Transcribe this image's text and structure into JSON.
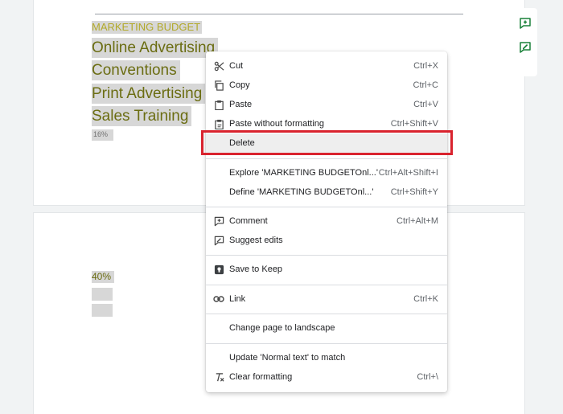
{
  "document": {
    "heading": "MARKETING BUDGET",
    "items": [
      "Online Advertising",
      "Conventions",
      "Print Advertising",
      "Sales Training"
    ],
    "small_value": "16%",
    "page2_value": "40%"
  },
  "context_menu": {
    "cut": {
      "label": "Cut",
      "shortcut": "Ctrl+X",
      "icon": "scissors-icon"
    },
    "copy": {
      "label": "Copy",
      "shortcut": "Ctrl+C",
      "icon": "copy-icon"
    },
    "paste": {
      "label": "Paste",
      "shortcut": "Ctrl+V",
      "icon": "clipboard-icon"
    },
    "paste_plain": {
      "label": "Paste without formatting",
      "shortcut": "Ctrl+Shift+V",
      "icon": "clipboard-text-icon"
    },
    "delete": {
      "label": "Delete"
    },
    "explore": {
      "label": "Explore 'MARKETING BUDGETOnl...'",
      "shortcut": "Ctrl+Alt+Shift+I"
    },
    "define": {
      "label": "Define 'MARKETING BUDGETOnl...'",
      "shortcut": "Ctrl+Shift+Y"
    },
    "comment": {
      "label": "Comment",
      "shortcut": "Ctrl+Alt+M",
      "icon": "add-comment-icon"
    },
    "suggest": {
      "label": "Suggest edits",
      "icon": "suggest-edit-icon"
    },
    "keep": {
      "label": "Save to Keep",
      "icon": "keep-icon"
    },
    "link": {
      "label": "Link",
      "shortcut": "Ctrl+K",
      "icon": "link-icon"
    },
    "landscape": {
      "label": "Change page to landscape"
    },
    "update_style": {
      "label": "Update 'Normal text' to match"
    },
    "clear": {
      "label": "Clear formatting",
      "shortcut": "Ctrl+\\",
      "icon": "clear-format-icon"
    }
  },
  "colors": {
    "highlight_box": "#d9232e",
    "selection": "#d7d7d7",
    "text_olive": "#6b6d12",
    "icon_green": "#188038"
  }
}
